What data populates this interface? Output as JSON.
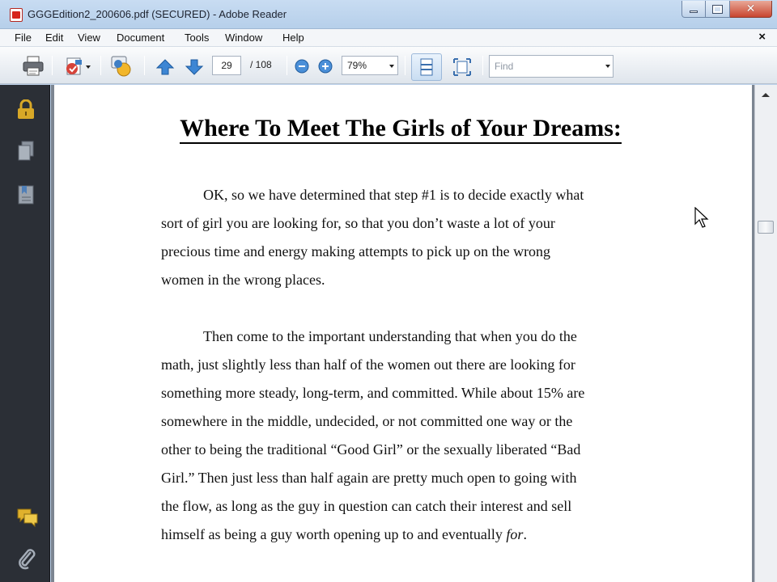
{
  "window": {
    "title": "GGGEdition2_200606.pdf (SECURED) - Adobe Reader"
  },
  "menu": {
    "items": [
      "File",
      "Edit",
      "View",
      "Document",
      "Tools",
      "Window",
      "Help"
    ],
    "close_glyph": "×"
  },
  "toolbar": {
    "current_page": "29",
    "total_pages": "/ 108",
    "zoom": "79%",
    "find_placeholder": "Find",
    "icons": [
      "print-icon",
      "attach-email-icon",
      "collaborate-icon",
      "previous-page-icon",
      "next-page-icon",
      "zoom-out-icon",
      "zoom-in-icon",
      "single-page-view-icon",
      "fit-window-icon"
    ]
  },
  "nav_pane": {
    "icons": [
      "lock-icon",
      "pages-icon",
      "bookmarks-icon",
      "comments-icon",
      "attachments-icon"
    ]
  },
  "document": {
    "heading": "Where To Meet The Girls of Your Dreams:",
    "paragraphs": [
      {
        "lines": [
          "OK, so we have determined that step #1 is to decide exactly what",
          "sort of girl you are looking for, so that you don’t waste a lot of your",
          "precious time and energy making attempts to pick up on the wrong",
          "women in the wrong places."
        ]
      },
      {
        "lines": [
          "Then come to the important understanding that when you do the",
          "math, just slightly less than half of the women out there are looking for",
          "something more steady, long-term, and committed. While about 15% are",
          "somewhere in the middle, undecided, or not committed one way or the",
          "other to being the traditional “Good Girl” or the sexually liberated “Bad",
          "Girl.” Then just less than half again are pretty much open to going with",
          "the flow, as long as the guy in question can catch their interest and sell",
          "himself as being a guy worth opening up to and eventually"
        ],
        "last_line_italic": "for",
        "last_line_end": "."
      }
    ]
  },
  "colors": {
    "nav_pane": "#2b2f36",
    "lock_icon": "#d8a827",
    "nav_icon": "#9aa2ad",
    "page_background": "#ffffff",
    "document_background": "#7c8591"
  }
}
